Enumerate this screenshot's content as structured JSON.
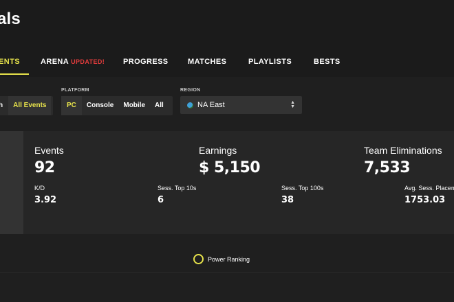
{
  "header": {
    "title": "als"
  },
  "tabs": [
    {
      "label": "ENTS",
      "active": true
    },
    {
      "label": "ARENA",
      "badge": "UPDATED!"
    },
    {
      "label": "PROGRESS"
    },
    {
      "label": "MATCHES"
    },
    {
      "label": "PLAYLISTS"
    },
    {
      "label": "BESTS"
    }
  ],
  "filters": {
    "events": {
      "options": [
        "h",
        "All Events"
      ],
      "selected": "All Events"
    },
    "platform": {
      "label": "PLATFORM",
      "options": [
        "PC",
        "Console",
        "Mobile",
        "All"
      ],
      "selected": "PC"
    },
    "region": {
      "label": "REGION",
      "value": "NA East",
      "icon": "globe-icon"
    }
  },
  "stats": {
    "primary": [
      {
        "label": "Events",
        "value": "92"
      },
      {
        "label": "Earnings",
        "value": "$ 5,150"
      },
      {
        "label": "Team Eliminations",
        "value": "7,533"
      }
    ],
    "secondary": [
      {
        "label": "K/D",
        "value": "3.92"
      },
      {
        "label": "Sess. Top 10s",
        "value": "6"
      },
      {
        "label": "Sess. Top 100s",
        "value": "38"
      },
      {
        "label": "Avg. Sess. Placem",
        "value": "1753.03"
      }
    ]
  },
  "chart": {
    "legend": "Power Ranking"
  },
  "colors": {
    "accent": "#e7e34b",
    "badge": "#e23c3c",
    "background": "#1f1f1f",
    "panel": "#262626"
  }
}
